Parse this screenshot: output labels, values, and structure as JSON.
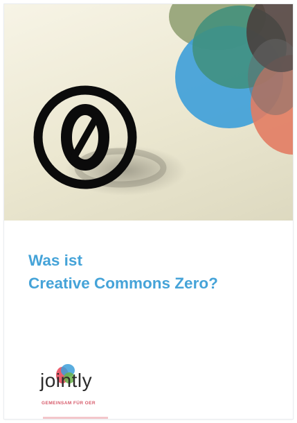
{
  "cover": {
    "title_line_1": "Was ist",
    "title_line_2": "Creative Commons Zero?",
    "title_color": "#45a3d8"
  },
  "hero": {
    "background": "#ebe7d0",
    "symbol": "cc-zero-icon",
    "symbol_glyph": "0",
    "shapes": [
      {
        "name": "olive-shape",
        "color": "#8d9c6e"
      },
      {
        "name": "teal-shape",
        "color": "#3f8f7b"
      },
      {
        "name": "blue-shape",
        "color": "#3d9fd9"
      },
      {
        "name": "dark-shape",
        "color": "#4a3b3a"
      },
      {
        "name": "orange-shape",
        "color": "#e27c63"
      }
    ]
  },
  "logo": {
    "wordmark": "jointly",
    "tagline": "GEMEINSAM FÜR OER",
    "accent_colors": [
      "#e94e5e",
      "#3d9fd9",
      "#6bb34a"
    ]
  }
}
